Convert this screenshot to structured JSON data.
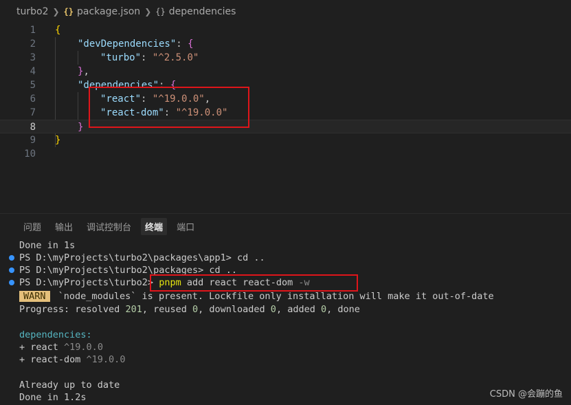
{
  "breadcrumb": {
    "folder": "turbo2",
    "file_icon": "{}",
    "file": "package.json",
    "node_icon": "{}",
    "node": "dependencies"
  },
  "editor": {
    "line_numbers": [
      "1",
      "2",
      "3",
      "4",
      "5",
      "6",
      "7",
      "8",
      "9",
      "10"
    ],
    "current_line": "8",
    "lines": {
      "l1_open": "{",
      "l2_key": "\"devDependencies\"",
      "l2_colon": ": ",
      "l2_brace": "{",
      "l3_key": "\"turbo\"",
      "l3_colon": ": ",
      "l3_val": "\"^2.5.0\"",
      "l4_brace": "}",
      "l4_comma": ",",
      "l5_key": "\"dependencies\"",
      "l5_colon": ": ",
      "l5_brace": "{",
      "l6_key": "\"react\"",
      "l6_colon": ": ",
      "l6_val": "\"^19.0.0\"",
      "l6_comma": ",",
      "l7_key": "\"react-dom\"",
      "l7_colon": ": ",
      "l7_val": "\"^19.0.0\"",
      "l8_brace": "}",
      "l9_close": "}"
    }
  },
  "panel": {
    "tabs": [
      "问题",
      "输出",
      "调试控制台",
      "终端",
      "端口"
    ],
    "active_tab": "终端"
  },
  "terminal": {
    "done1": "Done in 1s",
    "ps1_prompt": "PS D:\\myProjects\\turbo2\\packages\\app1> ",
    "ps1_cmd": "cd ..",
    "ps2_prompt": "PS D:\\myProjects\\turbo2\\packages> ",
    "ps2_cmd": "cd ..",
    "ps3_prompt": "PS D:\\myProjects\\turbo2> ",
    "ps3_cmd_pnpm": "pnpm",
    "ps3_cmd_args": " add react react-dom ",
    "ps3_cmd_flag": "-w",
    "warn_badge": "WARN",
    "warn_text": " `node_modules` is present. Lockfile only installation will make it out-of-date",
    "progress_label": "Progress: resolved ",
    "progress_resolved": "201",
    "progress_reused_label": ", reused ",
    "progress_reused": "0",
    "progress_downloaded_label": ", downloaded ",
    "progress_downloaded": "0",
    "progress_added_label": ", added ",
    "progress_added": "0",
    "progress_done": ", done",
    "deps_header": "dependencies:",
    "dep1_plus": "+ ",
    "dep1_name": "react ",
    "dep1_ver": "^19.0.0",
    "dep2_plus": "+ ",
    "dep2_name": "react-dom ",
    "dep2_ver": "^19.0.0",
    "uptodate": "Already up to date",
    "done2": "Done in 1.2s"
  },
  "watermark": "CSDN @会蹦的鱼",
  "colors": {
    "background": "#1f1f1f",
    "annotation_red": "#e0151a",
    "prompt_dot": "#3794ff"
  }
}
